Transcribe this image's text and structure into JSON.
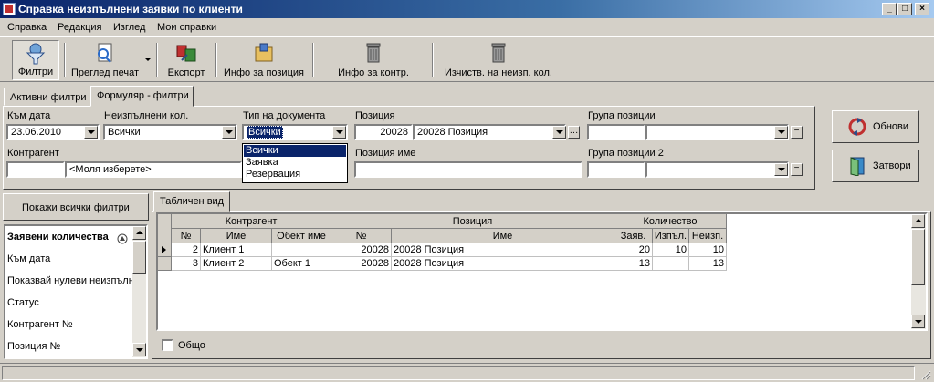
{
  "window": {
    "title": "Справка неизпълнени заявки по клиенти",
    "controls": [
      "_",
      "□",
      "×"
    ]
  },
  "menu": [
    "Справка",
    "Редакция",
    "Изглед",
    "Мои справки"
  ],
  "toolbar": {
    "filters": "Филтри",
    "print_preview": "Преглед печат",
    "export": "Експорт",
    "item_info": "Инфо за позиция",
    "contractor_info": "Инфо за контр.",
    "clear_qty": "Изчиств. на неизп. кол."
  },
  "tabs": {
    "active_filters": "Активни филтри",
    "filter_form": "Формуляр - филтри"
  },
  "form": {
    "to_date_label": "Към дата",
    "to_date_value": "23.06.2010",
    "unfulfilled_qty_label": "Неизпълнени кол.",
    "unfulfilled_qty_value": "Всички",
    "doc_type_label": "Тип на документа",
    "doc_type_value": "Всички",
    "doc_type_options": [
      "Всички",
      "Заявка",
      "Резервация"
    ],
    "item_label": "Позиция",
    "item_code": "20028",
    "item_value": "20028 Позиция",
    "item_group_label": "Група позиции",
    "contractor_label": "Контрагент",
    "contractor_value": "<Моля изберете>",
    "item_name_label": "Позиция име",
    "item_group2_label": "Група позиции 2"
  },
  "buttons": {
    "refresh": "Обнови",
    "close": "Затвори"
  },
  "left_panel": {
    "show_all": "Покажи всички филтри",
    "items": [
      "Заявени количества",
      "Към дата",
      "Показвай нулеви неизпълнени",
      "Статус",
      "Контрагент №",
      "Позиция №"
    ]
  },
  "grid": {
    "tab": "Табличен вид",
    "groups": {
      "contractor": "Контрагент",
      "item": "Позиция",
      "quantity": "Количество"
    },
    "columns": {
      "c_no": "№",
      "c_name": "Име",
      "c_object": "Обект име",
      "i_no": "№",
      "i_name": "Име",
      "q_ordered": "Заяв.",
      "q_done": "Изпъл.",
      "q_left": "Неизп."
    },
    "rows": [
      {
        "c_no": "2",
        "c_name": "Клиент 1",
        "c_object": "",
        "i_no": "20028",
        "i_name": "20028 Позиция",
        "q_ordered": "20",
        "q_done": "10",
        "q_left": "10"
      },
      {
        "c_no": "3",
        "c_name": "Клиент 2",
        "c_object": "Обект 1",
        "i_no": "20028",
        "i_name": "20028 Позиция",
        "q_ordered": "13",
        "q_done": "",
        "q_left": "13"
      }
    ],
    "total_label": "Общо"
  },
  "colors": {
    "title_bar": "#0a246a",
    "selection": "#0a246a",
    "face": "#d4d0c8"
  }
}
